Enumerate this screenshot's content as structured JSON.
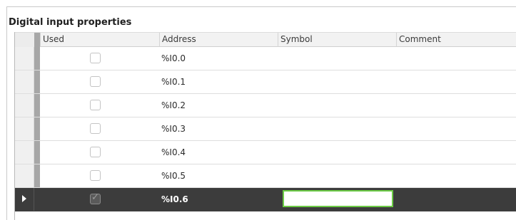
{
  "panel": {
    "title": "Digital input properties"
  },
  "table": {
    "columns": {
      "used": "Used",
      "address": "Address",
      "symbol": "Symbol",
      "comment": "Comment"
    },
    "rows": [
      {
        "address": "%I0.0",
        "used": false,
        "symbol": "",
        "comment": ""
      },
      {
        "address": "%I0.1",
        "used": false,
        "symbol": "",
        "comment": ""
      },
      {
        "address": "%I0.2",
        "used": false,
        "symbol": "",
        "comment": ""
      },
      {
        "address": "%I0.3",
        "used": false,
        "symbol": "",
        "comment": ""
      },
      {
        "address": "%I0.4",
        "used": false,
        "symbol": "",
        "comment": ""
      },
      {
        "address": "%I0.5",
        "used": false,
        "symbol": "",
        "comment": ""
      },
      {
        "address": "%I0.6",
        "used": true,
        "symbol": "",
        "comment": "",
        "selected": true
      }
    ]
  },
  "colors": {
    "selected_row": "#3c3c3c",
    "edit_border": "#6ccb46"
  }
}
